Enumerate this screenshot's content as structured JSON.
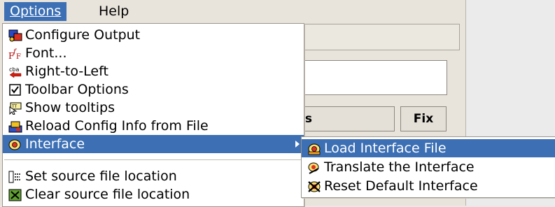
{
  "menubar": {
    "options": "Options",
    "help": "Help"
  },
  "background": {
    "button_partial": "ıs",
    "fix_button": "Fix"
  },
  "options_menu": {
    "items": [
      {
        "label": "Configure Output",
        "icon": "configure-output-icon"
      },
      {
        "label": "Font...",
        "icon": "font-icon"
      },
      {
        "label": "Right-to-Left",
        "icon": "right-to-left-icon"
      },
      {
        "label": "Toolbar Options",
        "icon": "toolbar-options-icon"
      },
      {
        "label": "Show tooltips",
        "icon": "tooltips-icon"
      },
      {
        "label": "Reload Config Info from File",
        "icon": "reload-config-icon"
      },
      {
        "label": "Interface",
        "icon": "interface-icon"
      },
      {
        "label": "Set source file location",
        "icon": "set-source-icon"
      },
      {
        "label": "Clear source file location",
        "icon": "clear-source-icon"
      }
    ]
  },
  "interface_submenu": {
    "items": [
      {
        "label": "Load Interface File",
        "icon": "load-interface-icon"
      },
      {
        "label": "Translate the Interface",
        "icon": "translate-interface-icon"
      },
      {
        "label": "Reset Default Interface",
        "icon": "reset-interface-icon"
      }
    ]
  },
  "colors": {
    "highlight": "#3c6fb4",
    "menu_bg": "#ffffff",
    "window_bg": "#e8e4dc"
  }
}
